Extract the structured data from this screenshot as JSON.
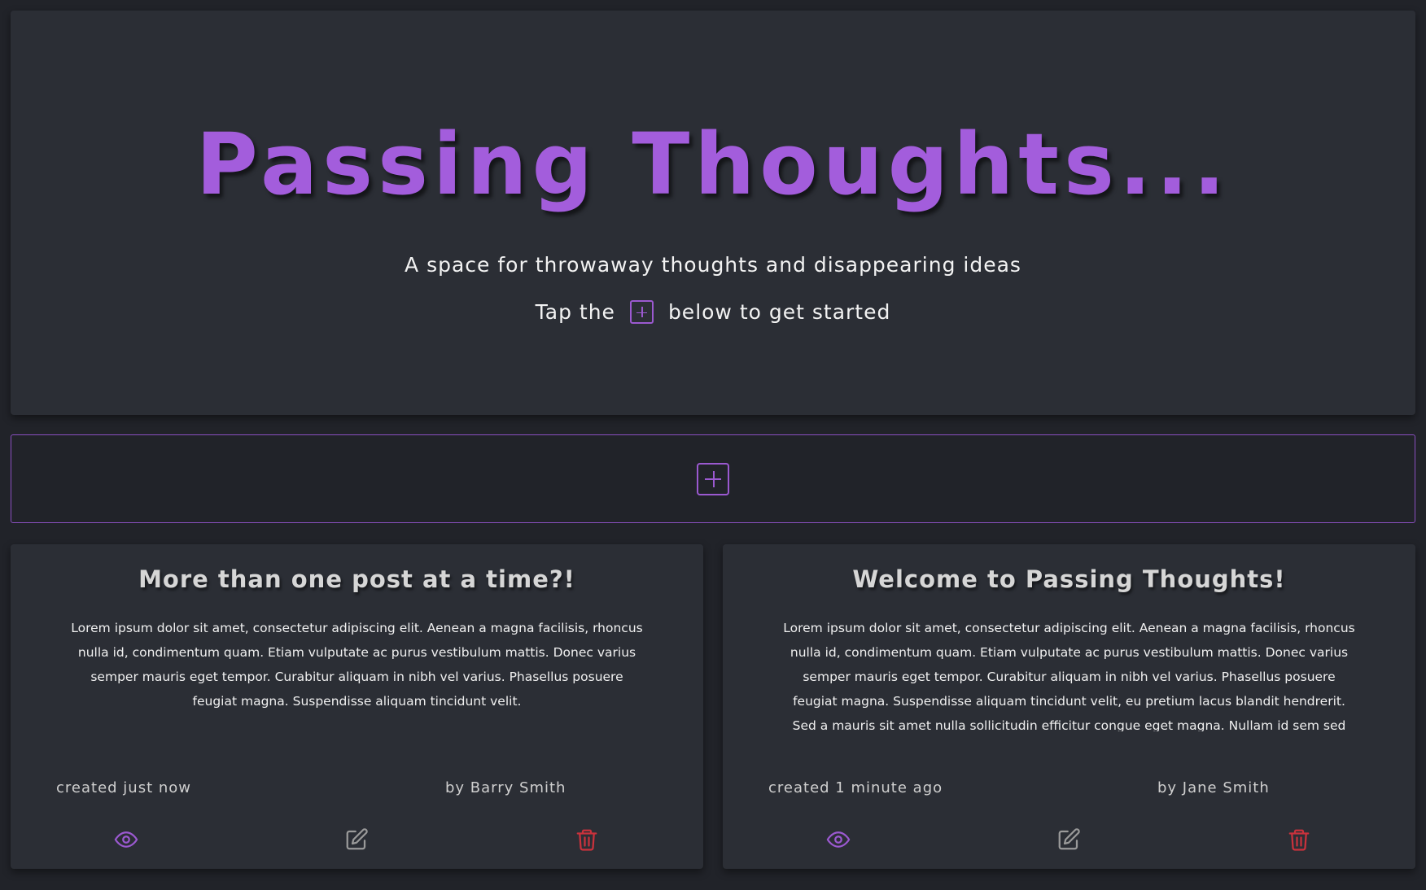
{
  "hero": {
    "title": "Passing Thoughts...",
    "subtitle": "A space for throwaway thoughts and disappearing ideas",
    "hint_before": "Tap the",
    "hint_after": "below to get started"
  },
  "colors": {
    "accent": "#9b59d0",
    "danger": "#c9323c",
    "background": "#212329",
    "panel": "#2b2e35"
  },
  "posts": [
    {
      "title": "More than one post at a time?!",
      "body": "Lorem ipsum dolor sit amet, consectetur adipiscing elit. Aenean a magna facilisis, rhoncus nulla id, condimentum quam. Etiam vulputate ac purus vestibulum mattis. Donec varius semper mauris eget tempor. Curabitur aliquam in nibh vel varius. Phasellus posuere feugiat magna. Suspendisse aliquam tincidunt velit.",
      "created": "created just now",
      "author": "by Barry Smith"
    },
    {
      "title": "Welcome to Passing Thoughts!",
      "body": "Lorem ipsum dolor sit amet, consectetur adipiscing elit. Aenean a magna facilisis, rhoncus nulla id, condimentum quam. Etiam vulputate ac purus vestibulum mattis. Donec varius semper mauris eget tempor. Curabitur aliquam in nibh vel varius. Phasellus posuere feugiat magna. Suspendisse aliquam tincidunt velit, eu pretium lacus blandit hendrerit. Sed a mauris sit amet nulla sollicitudin efficitur congue eget magna. Nullam id sem sed eros sodales facilisis. Aliquam tempus lectus mi, ac",
      "created": "created 1 minute ago",
      "author": "by Jane Smith"
    }
  ],
  "icons": {
    "add": "plus-square-icon",
    "view": "eye-icon",
    "edit": "pencil-square-icon",
    "delete": "trash-icon"
  }
}
